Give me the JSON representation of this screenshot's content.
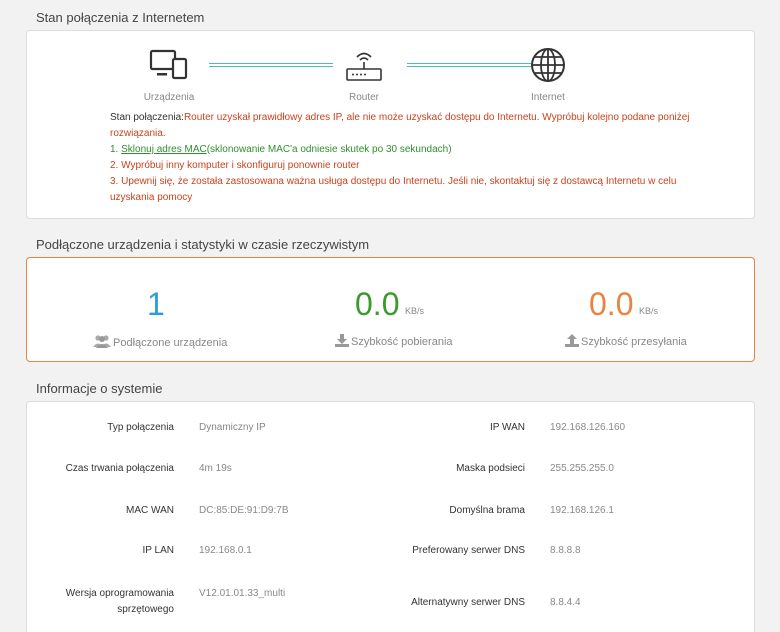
{
  "sections": {
    "status_title": "Stan połączenia z Internetem",
    "devices_title": "Podłączone urządzenia i statystyki w czasie rzeczywistym",
    "info_title": "Informacje o systemie"
  },
  "diagram": {
    "nodes": [
      {
        "label": "Urządzenia",
        "icon": "devices-icon"
      },
      {
        "label": "Router",
        "icon": "router-icon"
      },
      {
        "label": "Internet",
        "icon": "globe-icon"
      }
    ],
    "link_color": "#4cb8c9"
  },
  "status": {
    "prefix": "Stan połączenia:",
    "text": "Router uzyskał prawidłowy adres IP, ale nie może uzyskać dostępu do Internetu. Wypróbuj kolejno podane poniżej rozwiązania.",
    "step1_prefix": "1. ",
    "step1_link": "Sklonuj adres MAC",
    "step1_rest": "(sklonowanie MAC'a odniesie skutek po 30 sekundach)",
    "step2": "2. Wypróbuj inny komputer i skonfiguruj ponownie router",
    "step3": "3. Upewnij się, że została zastosowana ważna usługa dostępu do Internetu. Jeśli nie, skontaktuj się z dostawcą Internetu w celu uzyskania pomocy"
  },
  "stats": {
    "devices": {
      "value": "1",
      "caption": "Podłączone urządzenia",
      "icon": "users-icon",
      "color": "#2a9fd6"
    },
    "download": {
      "value": "0.0",
      "unit": "KB/s",
      "caption": "Szybkość pobierania",
      "icon": "download-icon",
      "color": "#3a9a2e"
    },
    "upload": {
      "value": "0.0",
      "unit": "KB/s",
      "caption": "Szybkość przesyłania",
      "icon": "upload-icon",
      "color": "#e8843e"
    }
  },
  "info": {
    "left": [
      {
        "key": "Typ połączenia",
        "value": "Dynamiczny IP"
      },
      {
        "key": "Czas trwania połączenia",
        "value": "4m 19s"
      },
      {
        "key": "MAC WAN",
        "value": "DC:85:DE:91:D9:7B"
      },
      {
        "key": "IP LAN",
        "value": "192.168.0.1"
      },
      {
        "key": "Wersja oprogramowania sprzętowego",
        "value": "V12.01.01.33_multi"
      }
    ],
    "right": [
      {
        "key": "IP WAN",
        "value": "192.168.126.160"
      },
      {
        "key": "Maska podsieci",
        "value": "255.255.255.0"
      },
      {
        "key": "Domyślna brama",
        "value": "192.168.126.1"
      },
      {
        "key": "Preferowany serwer DNS",
        "value": "8.8.8.8"
      },
      {
        "key": "Alternatywny serwer DNS",
        "value": "8.8.4.4"
      }
    ]
  }
}
